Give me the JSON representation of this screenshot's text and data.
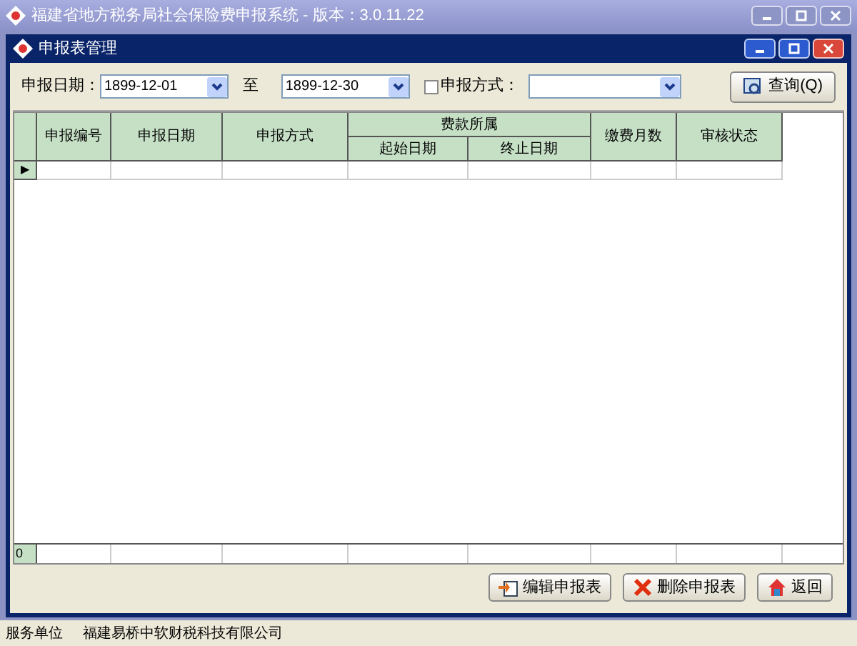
{
  "window": {
    "title": "福建省地方税务局社会保险费申报系统 - 版本：3.0.11.22"
  },
  "child_window": {
    "title": "申报表管理"
  },
  "filters": {
    "date_label": "申报日期：",
    "date_from": "1899-12-01",
    "to_label": "至",
    "date_to": "1899-12-30",
    "method_checkbox": {
      "label": "申报方式：",
      "checked": false
    },
    "query_button": "查询(Q)"
  },
  "table": {
    "columns": [
      "申报编号",
      "申报日期",
      "申报方式",
      {
        "group": "费款所属",
        "children": [
          "起始日期",
          "终止日期"
        ]
      },
      "缴费月数",
      "审核状态"
    ],
    "current_row_marker": "▶",
    "footer_count": "0"
  },
  "buttons": [
    "编辑申报表",
    "删除申报表",
    "返回"
  ],
  "status_bar": {
    "label": "服务单位",
    "value": "福建易桥中软财税科技有限公司"
  }
}
